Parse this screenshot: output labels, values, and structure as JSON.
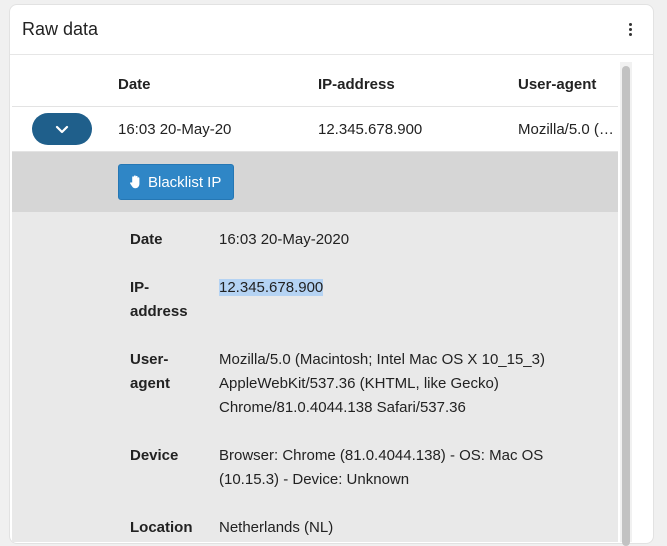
{
  "card": {
    "title": "Raw data",
    "menu_icon": "kebab-menu-icon"
  },
  "table": {
    "columns": [
      "Date",
      "IP-address",
      "User-agent"
    ],
    "rows": [
      {
        "date": "16:03 20-May-20",
        "ip": "12.345.678.900",
        "user_agent": "Mozilla/5.0 (Macintosh; Intel Mac OS X 10_15_3)",
        "toggle_icon": "chevron-down-icon"
      }
    ]
  },
  "detail": {
    "blacklist_button": "Blacklist IP",
    "blacklist_icon": "hand-icon",
    "button_color": "#2f86c6",
    "fields": [
      {
        "label": "Date",
        "value": "16:03 20-May-2020"
      },
      {
        "label": "IP-address",
        "label_line1": "IP-",
        "label_line2": "address",
        "value": "12.345.678.900",
        "highlighted": true
      },
      {
        "label": "User-agent",
        "label_line1": "User-",
        "label_line2": "agent",
        "value": "Mozilla/5.0 (Macintosh; Intel Mac OS X 10_15_3) AppleWebKit/537.36 (KHTML, like Gecko) Chrome/81.0.4044.138 Safari/537.36"
      },
      {
        "label": "Device",
        "value": "Browser: Chrome (81.0.4044.138) - OS: Mac OS (10.15.3) - Device: Unknown"
      },
      {
        "label": "Location",
        "value": "Netherlands (NL)"
      }
    ]
  },
  "colors": {
    "toggle_bg": "#1f5f8b",
    "detail_bg": "#e9e9e9",
    "action_bar_bg": "#d6d6d6",
    "highlight": "#b5d3f3"
  }
}
